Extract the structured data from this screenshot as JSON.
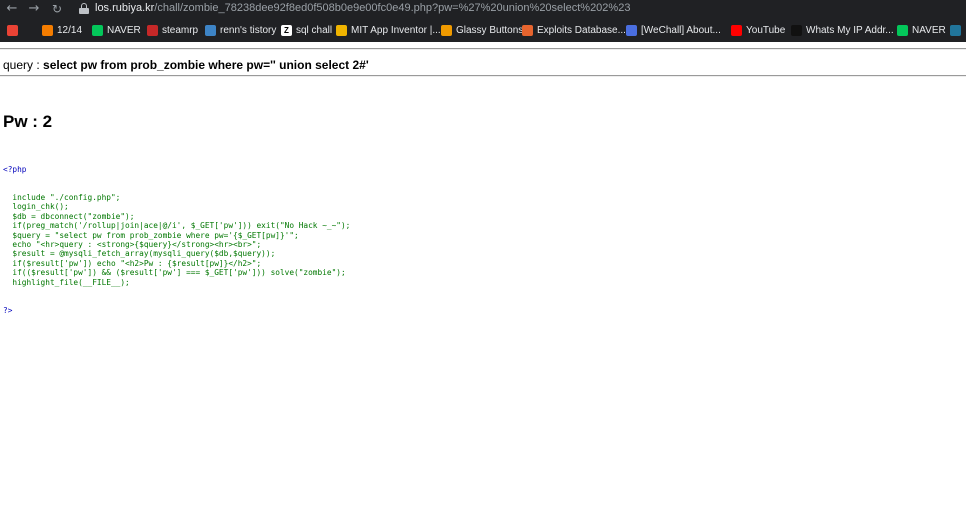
{
  "browser": {
    "url_host": "los.rubiya.kr",
    "url_path": "/chall/zombie_78238dee92f8ed0f508b0e9e00fc0e49.php?pw=%27%20union%20select%202%23",
    "bookmarks": [
      {
        "label": "",
        "icon": "apps-grid-icon",
        "color": "#ea4335"
      },
      {
        "label": "12/14",
        "icon": "blogger-icon",
        "color": "#f57d00"
      },
      {
        "label": "NAVER",
        "icon": "naver-icon",
        "color": "#03c75a"
      },
      {
        "label": "steamrp",
        "icon": "steam-icon",
        "color": "#c62828"
      },
      {
        "label": "renn's tistory",
        "icon": "tistory-icon",
        "color": "#3d84c6"
      },
      {
        "label": "sql chall",
        "icon": "zeta-icon",
        "color": "#ffffff"
      },
      {
        "label": "MIT App Inventor |...",
        "icon": "app-inventor-icon",
        "color": "#f0b400"
      },
      {
        "label": "Glassy Buttons",
        "icon": "glassy-icon",
        "color": "#f09a00"
      },
      {
        "label": "Exploits Database...",
        "icon": "exploit-db-icon",
        "color": "#e6642e"
      },
      {
        "label": "[WeChall] About...",
        "icon": "wechall-icon",
        "color": "#4a6ee0"
      },
      {
        "label": "YouTube",
        "icon": "youtube-icon",
        "color": "#ff0000"
      },
      {
        "label": "Whats My IP Addr...",
        "icon": "whatsmyip-icon",
        "color": "#111111"
      },
      {
        "label": "NAVER",
        "icon": "naver-icon",
        "color": "#03c75a"
      },
      {
        "label": "",
        "icon": "wordpress-icon",
        "color": "#21759b"
      }
    ]
  },
  "page": {
    "query_prefix": "query : ",
    "query_sql": "select pw from prob_zombie where pw='' union select 2#'",
    "pw_heading": "Pw : 2",
    "source_open": "<?php",
    "source_lines": [
      "  include \"./config.php\";",
      "  login_chk();",
      "  $db = dbconnect(\"zombie\");",
      "  if(preg_match('/rollup|join|ace|@/i', $_GET['pw'])) exit(\"No Hack ~_~\");",
      "  $query = \"select pw from prob_zombie where pw='{$_GET[pw]}'\";",
      "  echo \"<hr>query : <strong>{$query}</strong><hr><br>\";",
      "  $result = @mysqli_fetch_array(mysqli_query($db,$query));",
      "  if($result['pw']) echo \"<h2>Pw : {$result[pw]}</h2>\";",
      "  if(($result['pw']) && ($result['pw'] === $_GET['pw'])) solve(\"zombie\");",
      "  highlight_file(__FILE__);"
    ],
    "source_close": "?>"
  }
}
